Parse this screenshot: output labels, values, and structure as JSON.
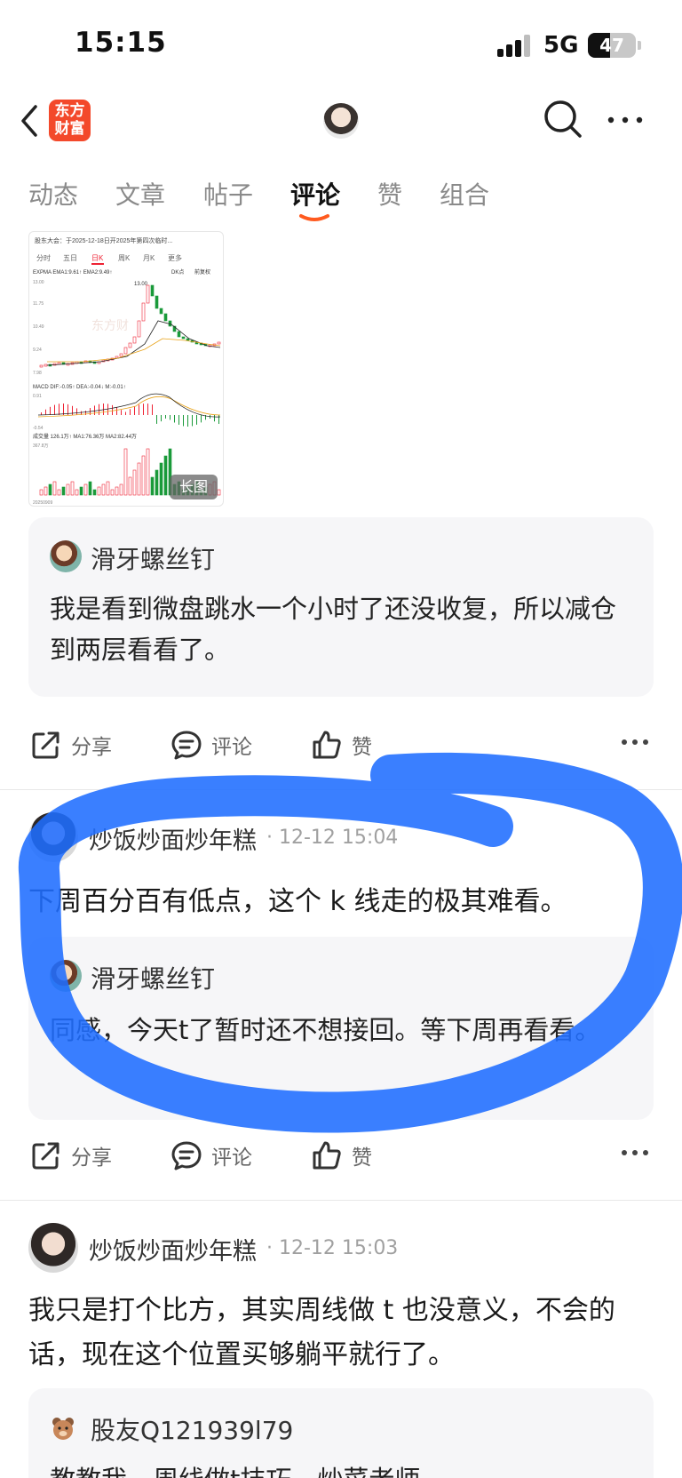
{
  "status_bar": {
    "time": "15:15",
    "network": "5G",
    "battery_percent": "47",
    "battery_level": 0.47
  },
  "nav": {
    "logo_text": "东方财富"
  },
  "tabs": [
    {
      "label": "动态",
      "active": false
    },
    {
      "label": "文章",
      "active": false
    },
    {
      "label": "帖子",
      "active": false
    },
    {
      "label": "评论",
      "active": true
    },
    {
      "label": "赞",
      "active": false
    },
    {
      "label": "组合",
      "active": false
    }
  ],
  "thumbnail": {
    "header_text": "股东大会：于2025-12-18日开2025年第四次临时...",
    "periods": [
      "分时",
      "五日",
      "日K",
      "周K",
      "月K",
      "更多"
    ],
    "indicator_line": "EXPMA  EMA1:9.61↑  EMA2:9.49↑",
    "dk_label": "DK点",
    "adj_label": "前复权",
    "price_high": "13.00",
    "axis_prices": [
      "13.00",
      "11.75",
      "10.49",
      "9.24",
      "7.98"
    ],
    "macd_line": "MACD  DIF:-0.05↑  DEA:-0.04↓  M:-0.01↑",
    "macd_axis": [
      "0.91",
      "-0.54"
    ],
    "volume_line": "成交量  126.1万↑  MA1:76.36万  MA2:82.44万",
    "volume_axis": "367.8万",
    "date_label": "20250909",
    "watermark": "东方财",
    "long_image_label": "长图"
  },
  "comment1": {
    "quote_author": "滑牙螺丝钉",
    "quote_text": "我是看到微盘跳水一个小时了还没收复，所以减仓到两层看看了。"
  },
  "actions": {
    "share": "分享",
    "comment": "评论",
    "like": "赞"
  },
  "post2": {
    "author": "炒饭炒面炒年糕",
    "meta": "· 12-12 15:04",
    "text": "下周百分百有低点，这个 k 线走的极其难看。",
    "quote_author": "滑牙螺丝钉",
    "quote_text": "同感，今天t了暂时还不想接回。等下周再看看。"
  },
  "post3": {
    "author": "炒饭炒面炒年糕",
    "meta": "· 12-12 15:03",
    "text": "我只是打个比方，其实周线做 t 也没意义，不会的话，现在这个位置买够躺平就行了。",
    "quote_author": "股友Q121939l79",
    "quote_text": "教教我，周线做t技巧，炒菜老师"
  },
  "colors": {
    "brand": "#f3492b",
    "tab_underline": "#ff5a1f",
    "marker": "#1f6dff"
  }
}
